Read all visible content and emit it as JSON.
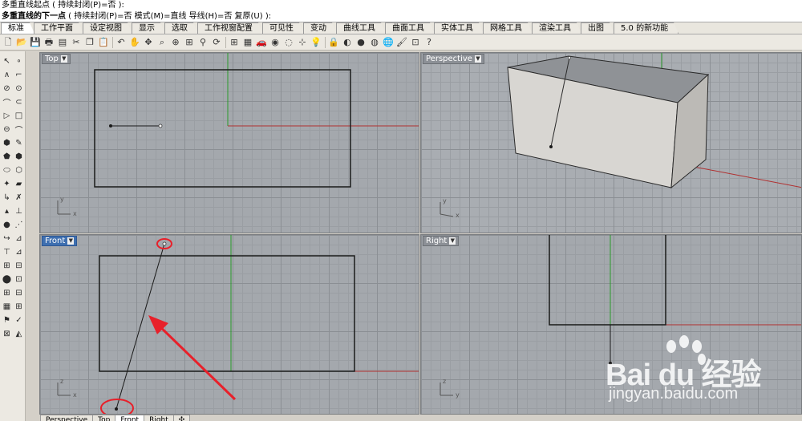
{
  "command": {
    "line1": "多重直线起点 ( 持续封闭(P)=否 ):",
    "line2_bold": "多重直线的下一点",
    "line2_rest": " ( 持续封闭(P)=否  模式(M)=直线  导线(H)=否  复原(U) ):"
  },
  "tabs": [
    {
      "label": "标准"
    },
    {
      "label": "工作平面"
    },
    {
      "label": "设定视图"
    },
    {
      "label": "显示"
    },
    {
      "label": "选取"
    },
    {
      "label": "工作视窗配置"
    },
    {
      "label": "可见性"
    },
    {
      "label": "变动"
    },
    {
      "label": "曲线工具"
    },
    {
      "label": "曲面工具"
    },
    {
      "label": "实体工具"
    },
    {
      "label": "网格工具"
    },
    {
      "label": "渲染工具"
    },
    {
      "label": "出图"
    },
    {
      "label": "5.0 的新功能"
    }
  ],
  "toolbar_icons": [
    "new-file",
    "open-file",
    "save",
    "print",
    "properties",
    "cut",
    "copy",
    "paste",
    "undo",
    "pan",
    "move",
    "zoom-window",
    "zoom-dynamic",
    "zoom-extents",
    "zoom-selected",
    "rotate-view",
    "four-viewports",
    "layers-panel",
    "car",
    "render-preview",
    "circle-dashed",
    "snap",
    "light-bulb",
    "lock",
    "color-wheel",
    "sphere-render",
    "ball-shaded",
    "blue-globe",
    "paint-bucket",
    "grid-snap",
    "help"
  ],
  "left_toolbar_rows": 20,
  "viewports": {
    "top": {
      "title": "Top",
      "axis_x": "x",
      "axis_y": "y"
    },
    "perspective": {
      "title": "Perspective",
      "axis_x": "x",
      "axis_y": "y"
    },
    "front": {
      "title": "Front",
      "axis_x": "x",
      "axis_y": "z"
    },
    "right": {
      "title": "Right",
      "axis_x": "y",
      "axis_y": "z"
    }
  },
  "bottom_tabs": [
    {
      "label": "Perspective"
    },
    {
      "label": "Top"
    },
    {
      "label": "Front"
    },
    {
      "label": "Right"
    },
    {
      "label": "✣"
    }
  ],
  "watermark": {
    "brand": "Bai du 经验",
    "url": "jingyan.baidu.com"
  },
  "colors": {
    "viewport_bg": "#a4a8ad",
    "active_title": "#3e6fb0",
    "x_axis": "#b03030",
    "y_axis": "#2a9a2a",
    "annotation": "#e8202a"
  }
}
